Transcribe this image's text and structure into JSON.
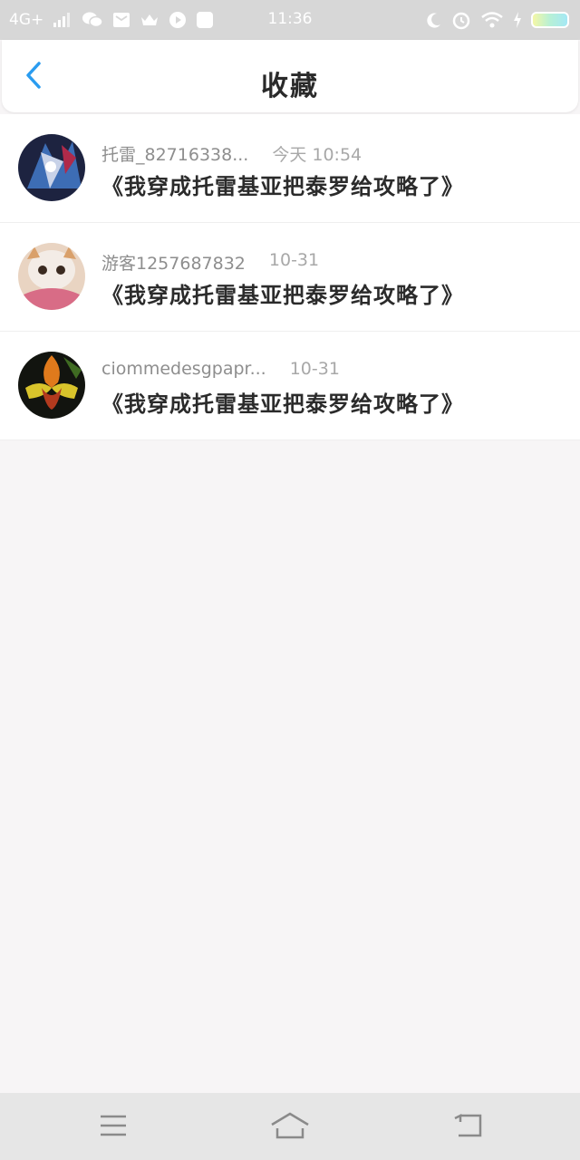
{
  "status_bar": {
    "network": "4G+",
    "time": "11:36"
  },
  "header": {
    "title": "收藏"
  },
  "favorites": [
    {
      "username": "托雷_82716338...",
      "time": "今天 10:54",
      "title": "《我穿成托雷基亚把泰罗给攻略了》"
    },
    {
      "username": "游客1257687832",
      "time": "10-31",
      "title": "《我穿成托雷基亚把泰罗给攻略了》"
    },
    {
      "username": "ciommedesgpapr...",
      "time": "10-31",
      "title": "《我穿成托雷基亚把泰罗给攻略了》"
    }
  ],
  "colors": {
    "accent": "#2a9cf0",
    "status_bar_bg": "#d7d7d7",
    "page_bg": "#f7f5f6",
    "nav_bg": "#e6e6e6"
  }
}
